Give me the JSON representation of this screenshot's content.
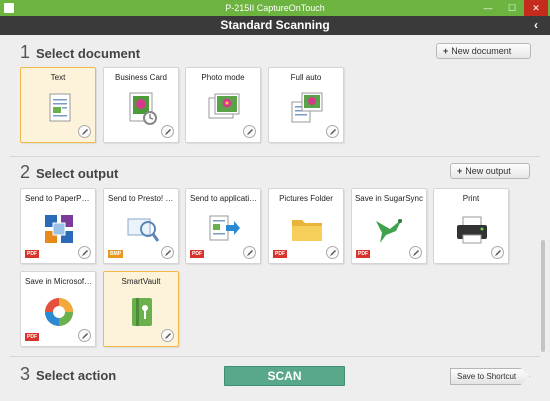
{
  "window": {
    "title": "P-215II CaptureOnTouch",
    "controls": [
      "—",
      "☐",
      "✕"
    ]
  },
  "header": {
    "title": "Standard Scanning",
    "back_label": "‹"
  },
  "sections": {
    "document": {
      "number": "1",
      "title": "Select document",
      "new_label": "New document",
      "new_plus": "+"
    },
    "output": {
      "number": "2",
      "title": "Select output",
      "new_label": "New output",
      "new_plus": "+"
    },
    "action": {
      "number": "3",
      "title": "Select action"
    }
  },
  "documents": [
    {
      "label": "Text",
      "icon": "text-document-icon",
      "selected": true
    },
    {
      "label": "Business Card",
      "icon": "business-card-icon",
      "selected": false
    },
    {
      "label": "Photo mode",
      "icon": "photo-mode-icon",
      "selected": false
    },
    {
      "label": "Full auto",
      "icon": "full-auto-icon",
      "selected": false
    }
  ],
  "outputs": [
    {
      "label": "Send to PaperPort ...",
      "icon": "paperport-icon",
      "badge": "PDF",
      "selected": false
    },
    {
      "label": "Send to Presto! Biz...",
      "icon": "presto-biz-icon",
      "badge": "BMP",
      "selected": false
    },
    {
      "label": "Send to application",
      "icon": "send-to-application-icon",
      "badge": "PDF",
      "selected": false
    },
    {
      "label": "Pictures Folder",
      "icon": "folder-icon",
      "badge": "PDF",
      "selected": false
    },
    {
      "label": "Save in SugarSync",
      "icon": "sugarsync-icon",
      "badge": "PDF",
      "selected": false
    },
    {
      "label": "Print",
      "icon": "printer-icon",
      "badge": "",
      "selected": false
    },
    {
      "label": "Save in Microsoft S...",
      "icon": "microsoft-sharepoint-icon",
      "badge": "PDF",
      "selected": false
    },
    {
      "label": "SmartVault",
      "icon": "smartvault-icon",
      "badge": "",
      "selected": true
    }
  ],
  "actions": {
    "scan_label": "SCAN",
    "shortcut_label": "Save to Shortcut"
  },
  "colors": {
    "titlebar": "#6cb33f",
    "header": "#3a3a3a",
    "scan": "#5aa88a",
    "selected_card": "#fdf3da",
    "selected_border": "#f0b94a",
    "pdf_badge": "#d9342b",
    "bmp_badge": "#e89a1e"
  }
}
